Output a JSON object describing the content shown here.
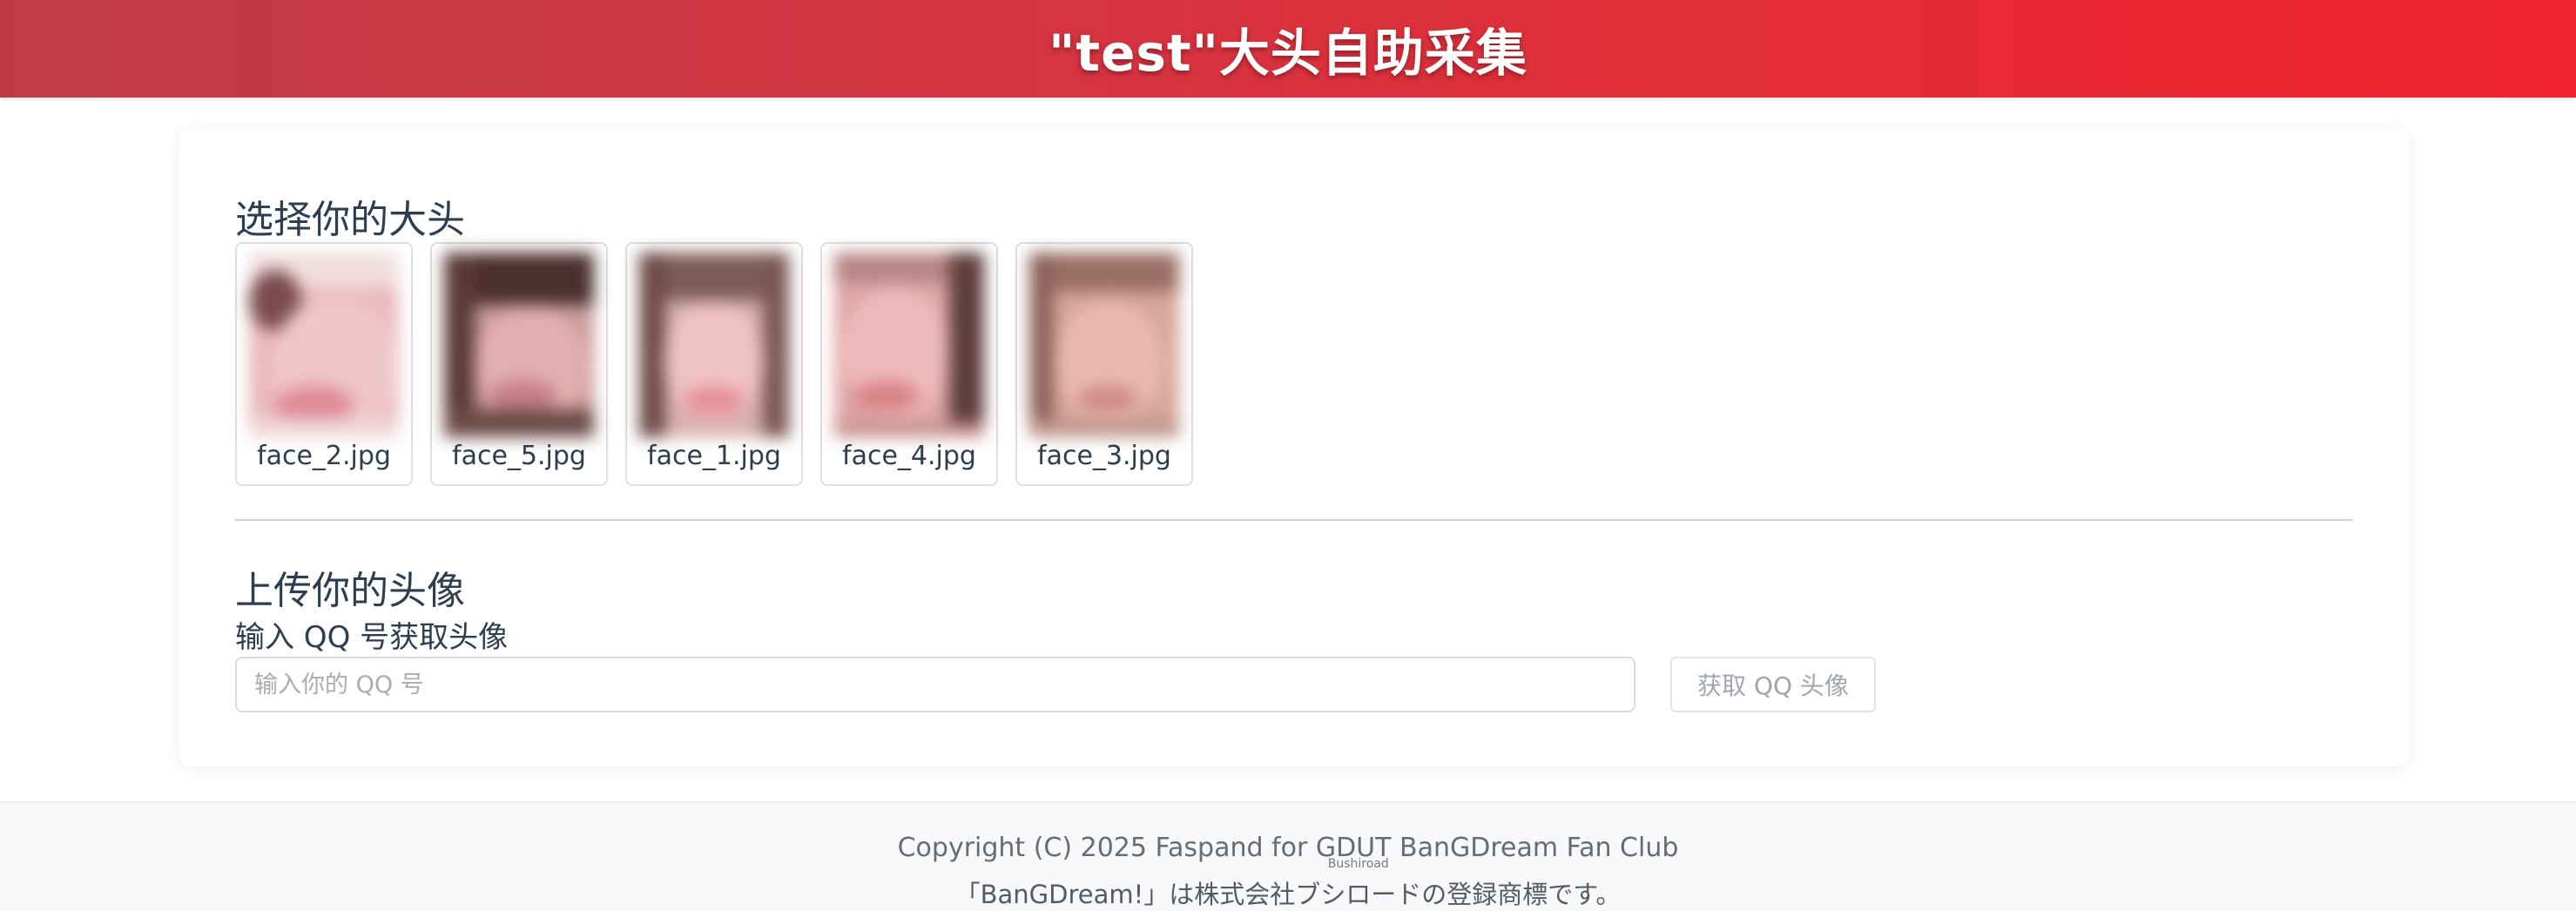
{
  "header": {
    "title": "\"test\"大头自助采集"
  },
  "select_section": {
    "title": "选择你的大头",
    "faces": [
      {
        "filename": "face_2.jpg"
      },
      {
        "filename": "face_5.jpg"
      },
      {
        "filename": "face_1.jpg"
      },
      {
        "filename": "face_4.jpg"
      },
      {
        "filename": "face_3.jpg"
      }
    ]
  },
  "upload_section": {
    "title": "上传你的头像",
    "qq_label": "输入 QQ 号获取头像",
    "qq_placeholder": "输入你的 QQ 号",
    "qq_value": "",
    "fetch_button_label": "获取 QQ 头像"
  },
  "footer": {
    "copyright": "Copyright (C) 2025 Faspand for GDUT BanGDream Fan Club",
    "trademark_prefix": "「BanGDream!」は株式会社",
    "trademark_company": "ブシロード",
    "trademark_company_ruby": "Bushiroad",
    "trademark_suffix": "の登録商標です。"
  },
  "colors": {
    "header_gradient_start": "#bf3a48",
    "header_gradient_end": "#f2232d",
    "text_primary": "#2c3e50",
    "footer_bg": "#f7f8fa"
  }
}
